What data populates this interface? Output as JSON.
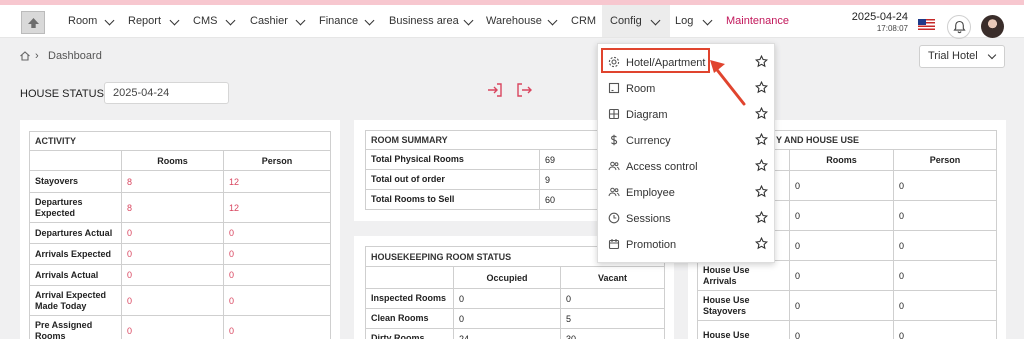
{
  "nav": {
    "items": [
      {
        "label": "Room"
      },
      {
        "label": "Report"
      },
      {
        "label": "CMS"
      },
      {
        "label": "Cashier"
      },
      {
        "label": "Finance"
      },
      {
        "label": "Business area"
      },
      {
        "label": "Warehouse"
      },
      {
        "label": "CRM"
      },
      {
        "label": "Config"
      },
      {
        "label": "Log"
      },
      {
        "label": "Maintenance"
      }
    ],
    "date": "2025-04-24",
    "time": "17:08:07"
  },
  "breadcrumb": {
    "current": "Dashboard"
  },
  "hotel_select": {
    "value": "Trial Hotel"
  },
  "house_status": {
    "label": "HOUSE STATUS",
    "date": "2025-04-24"
  },
  "activity": {
    "title": "ACTIVITY",
    "headers": [
      "Rooms",
      "Person"
    ],
    "rows": [
      {
        "label": "Stayovers",
        "rooms": "8",
        "person": "12"
      },
      {
        "label": "Departures Expected",
        "rooms": "8",
        "person": "12"
      },
      {
        "label": "Departures Actual",
        "rooms": "0",
        "person": "0"
      },
      {
        "label": "Arrivals Expected",
        "rooms": "0",
        "person": "0"
      },
      {
        "label": "Arrivals Actual",
        "rooms": "0",
        "person": "0"
      },
      {
        "label": "Arrival Expected Made Today",
        "rooms": "0",
        "person": "0"
      },
      {
        "label": "Pre Assigned Rooms",
        "rooms": "0",
        "person": "0"
      }
    ]
  },
  "room_summary": {
    "title": "ROOM SUMMARY",
    "rows": [
      {
        "label": "Total Physical Rooms",
        "value": "69"
      },
      {
        "label": "Total out of order",
        "value": "9"
      },
      {
        "label": "Total Rooms to Sell",
        "value": "60"
      }
    ]
  },
  "housekeeping": {
    "title": "HOUSEKEEPING ROOM STATUS",
    "headers": [
      "Occupied",
      "Vacant"
    ],
    "rows": [
      {
        "label": "Inspected Rooms",
        "occupied": "0",
        "vacant": "0"
      },
      {
        "label": "Clean Rooms",
        "occupied": "0",
        "vacant": "5"
      },
      {
        "label": "Dirty Rooms",
        "occupied": "24",
        "vacant": "30"
      }
    ]
  },
  "comp_house": {
    "title": "Y AND HOUSE USE",
    "headers": [
      "Rooms",
      "Person"
    ],
    "rows": [
      {
        "label": "",
        "rooms": "0",
        "person": "0"
      },
      {
        "label": "",
        "rooms": "0",
        "person": "0"
      },
      {
        "label": "",
        "rooms": "0",
        "person": "0"
      },
      {
        "label": "House Use Arrivals",
        "rooms": "0",
        "person": "0"
      },
      {
        "label": "House Use Stayovers",
        "rooms": "0",
        "person": "0"
      },
      {
        "label": "House Use",
        "rooms": "0",
        "person": "0"
      }
    ]
  },
  "config_menu": {
    "items": [
      {
        "label": "Hotel/Apartment",
        "icon": "gear-icon"
      },
      {
        "label": "Room",
        "icon": "room-icon"
      },
      {
        "label": "Diagram",
        "icon": "grid-icon"
      },
      {
        "label": "Currency",
        "icon": "dollar-icon"
      },
      {
        "label": "Access control",
        "icon": "users-icon"
      },
      {
        "label": "Employee",
        "icon": "users-icon"
      },
      {
        "label": "Sessions",
        "icon": "clock-icon"
      },
      {
        "label": "Promotion",
        "icon": "calendar-icon"
      }
    ]
  },
  "colors": {
    "accent": "#c2185b",
    "red_value": "#d9455f",
    "highlight": "#e0442e",
    "login_icon": "#d9455f"
  }
}
